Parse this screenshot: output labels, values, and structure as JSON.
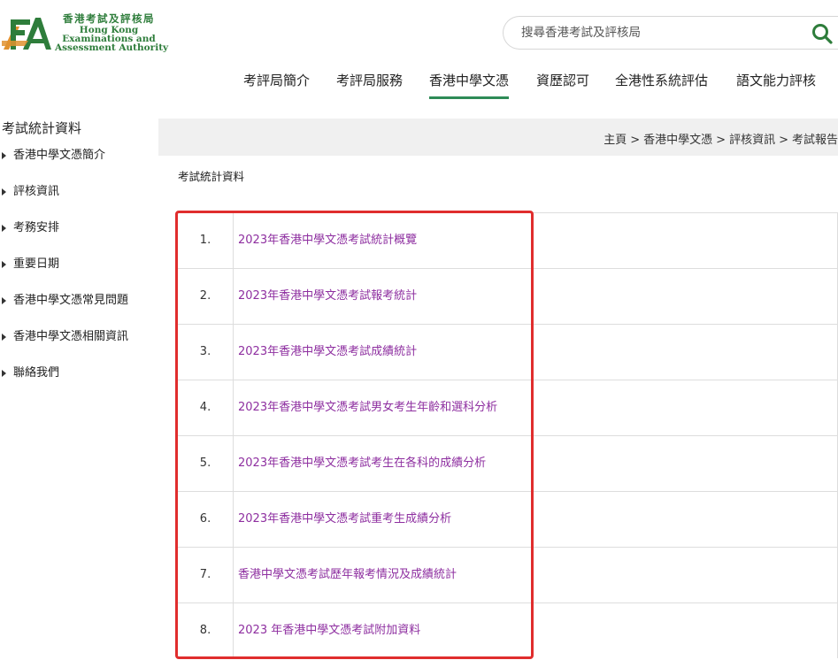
{
  "header": {
    "logo_zh": "香港考試及評核局",
    "logo_en_1": "Hong Kong",
    "logo_en_2": "Examinations and",
    "logo_en_3": "Assessment Authority",
    "logo_icon": "hkeaa-logo-mark",
    "search_placeholder": "搜尋香港考試及評核局",
    "search_icon": "search-icon"
  },
  "nav": {
    "items": [
      {
        "label": "考評局簡介"
      },
      {
        "label": "考評局服務"
      },
      {
        "label": "香港中學文憑",
        "active": true
      },
      {
        "label": "資歷認可"
      },
      {
        "label": "全港性系統評估"
      },
      {
        "label": "語文能力評核"
      }
    ]
  },
  "sidebar": {
    "title": "考試統計資料",
    "items": [
      {
        "label": "香港中學文憑簡介"
      },
      {
        "label": "評核資訊"
      },
      {
        "label": "考務安排"
      },
      {
        "label": "重要日期"
      },
      {
        "label": "香港中學文憑常見問題"
      },
      {
        "label": "香港中學文憑相關資訊"
      },
      {
        "label": "聯絡我們"
      }
    ]
  },
  "breadcrumb": {
    "items": [
      "主頁",
      "香港中學文憑",
      "評核資訊",
      "考試報告"
    ],
    "separator": ">"
  },
  "main": {
    "heading": "考試統計資料",
    "rows": [
      {
        "num": "1.",
        "label": "2023年香港中學文憑考試統計概覽"
      },
      {
        "num": "2.",
        "label": "2023年香港中學文憑考試報考統計"
      },
      {
        "num": "3.",
        "label": "2023年香港中學文憑考試成績統計"
      },
      {
        "num": "4.",
        "label": "2023年香港中學文憑考試男女考生年齡和選科分析"
      },
      {
        "num": "5.",
        "label": "2023年香港中學文憑考試考生在各科的成績分析"
      },
      {
        "num": "6.",
        "label": "2023年香港中學文憑考試重考生成績分析"
      },
      {
        "num": "7.",
        "label": "香港中學文憑考試歷年報考情況及成績統計"
      },
      {
        "num": "8.",
        "label": "2023 年香港中學文憑考試附加資料"
      }
    ]
  },
  "colors": {
    "brand_green": "#2e7d3b",
    "accent_orange": "#e0922f",
    "link_purple": "#8e2fa0",
    "highlight_red": "#e02d2d",
    "nav_underline": "#2e8b57"
  }
}
